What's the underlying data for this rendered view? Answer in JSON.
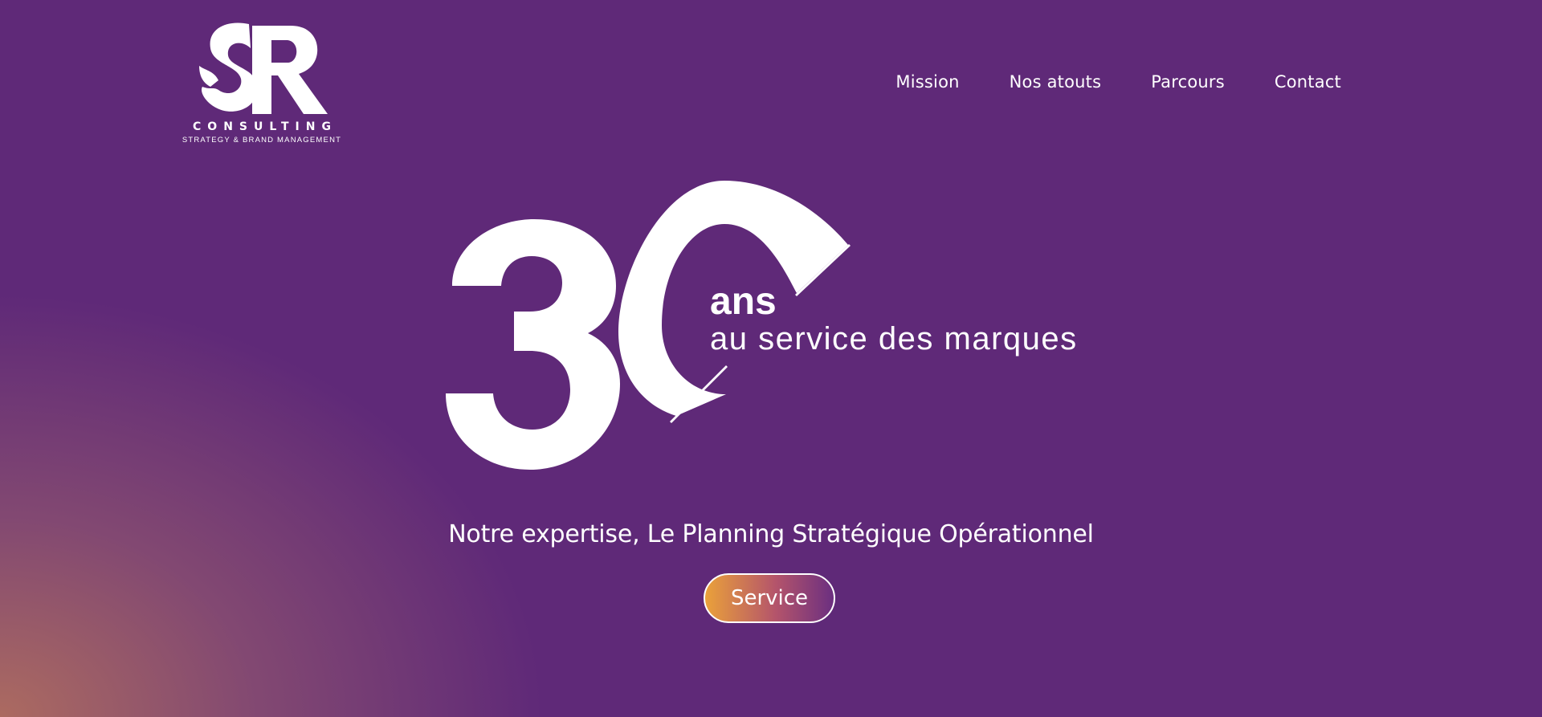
{
  "logo": {
    "letters": "SR",
    "consulting": "CONSULTING",
    "tagline": "STRATEGY & BRAND MANAGEMENT"
  },
  "nav": {
    "items": [
      {
        "label": "Mission"
      },
      {
        "label": "Nos atouts"
      },
      {
        "label": "Parcours"
      },
      {
        "label": "Contact"
      }
    ]
  },
  "hero": {
    "number": "30",
    "ans": "ans",
    "subtitle": "au service des marques",
    "expertise": "Notre expertise, Le Planning Stratégique Opérationnel",
    "cta_label": "Service"
  },
  "colors": {
    "background": "#5f2978",
    "corner_glow": "#b06e5f",
    "text": "#ffffff",
    "button_gradient_start": "#eaa13a",
    "button_gradient_end": "#6b2f80"
  }
}
